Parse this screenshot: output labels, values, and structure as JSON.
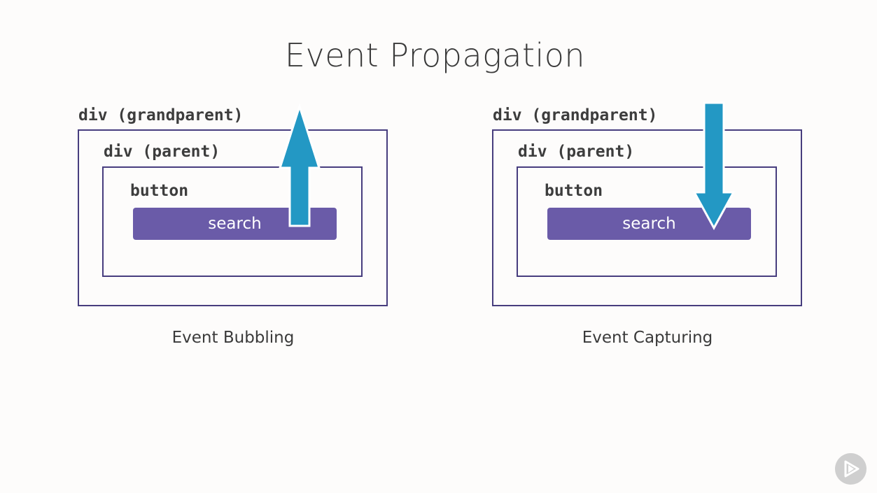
{
  "title": "Event Propagation",
  "colors": {
    "box_border": "#473d7e",
    "button_fill": "#6a5ba8",
    "arrow_fill": "#2398c4"
  },
  "diagrams": [
    {
      "grandparent_label": "div (grandparent)",
      "parent_label": "div (parent)",
      "button_label": "button",
      "search_label": "search",
      "arrow_direction": "up",
      "caption": "Event Bubbling"
    },
    {
      "grandparent_label": "div (grandparent)",
      "parent_label": "div (parent)",
      "button_label": "button",
      "search_label": "search",
      "arrow_direction": "down",
      "caption": "Event Capturing"
    }
  ],
  "badge_icon": "play-icon"
}
